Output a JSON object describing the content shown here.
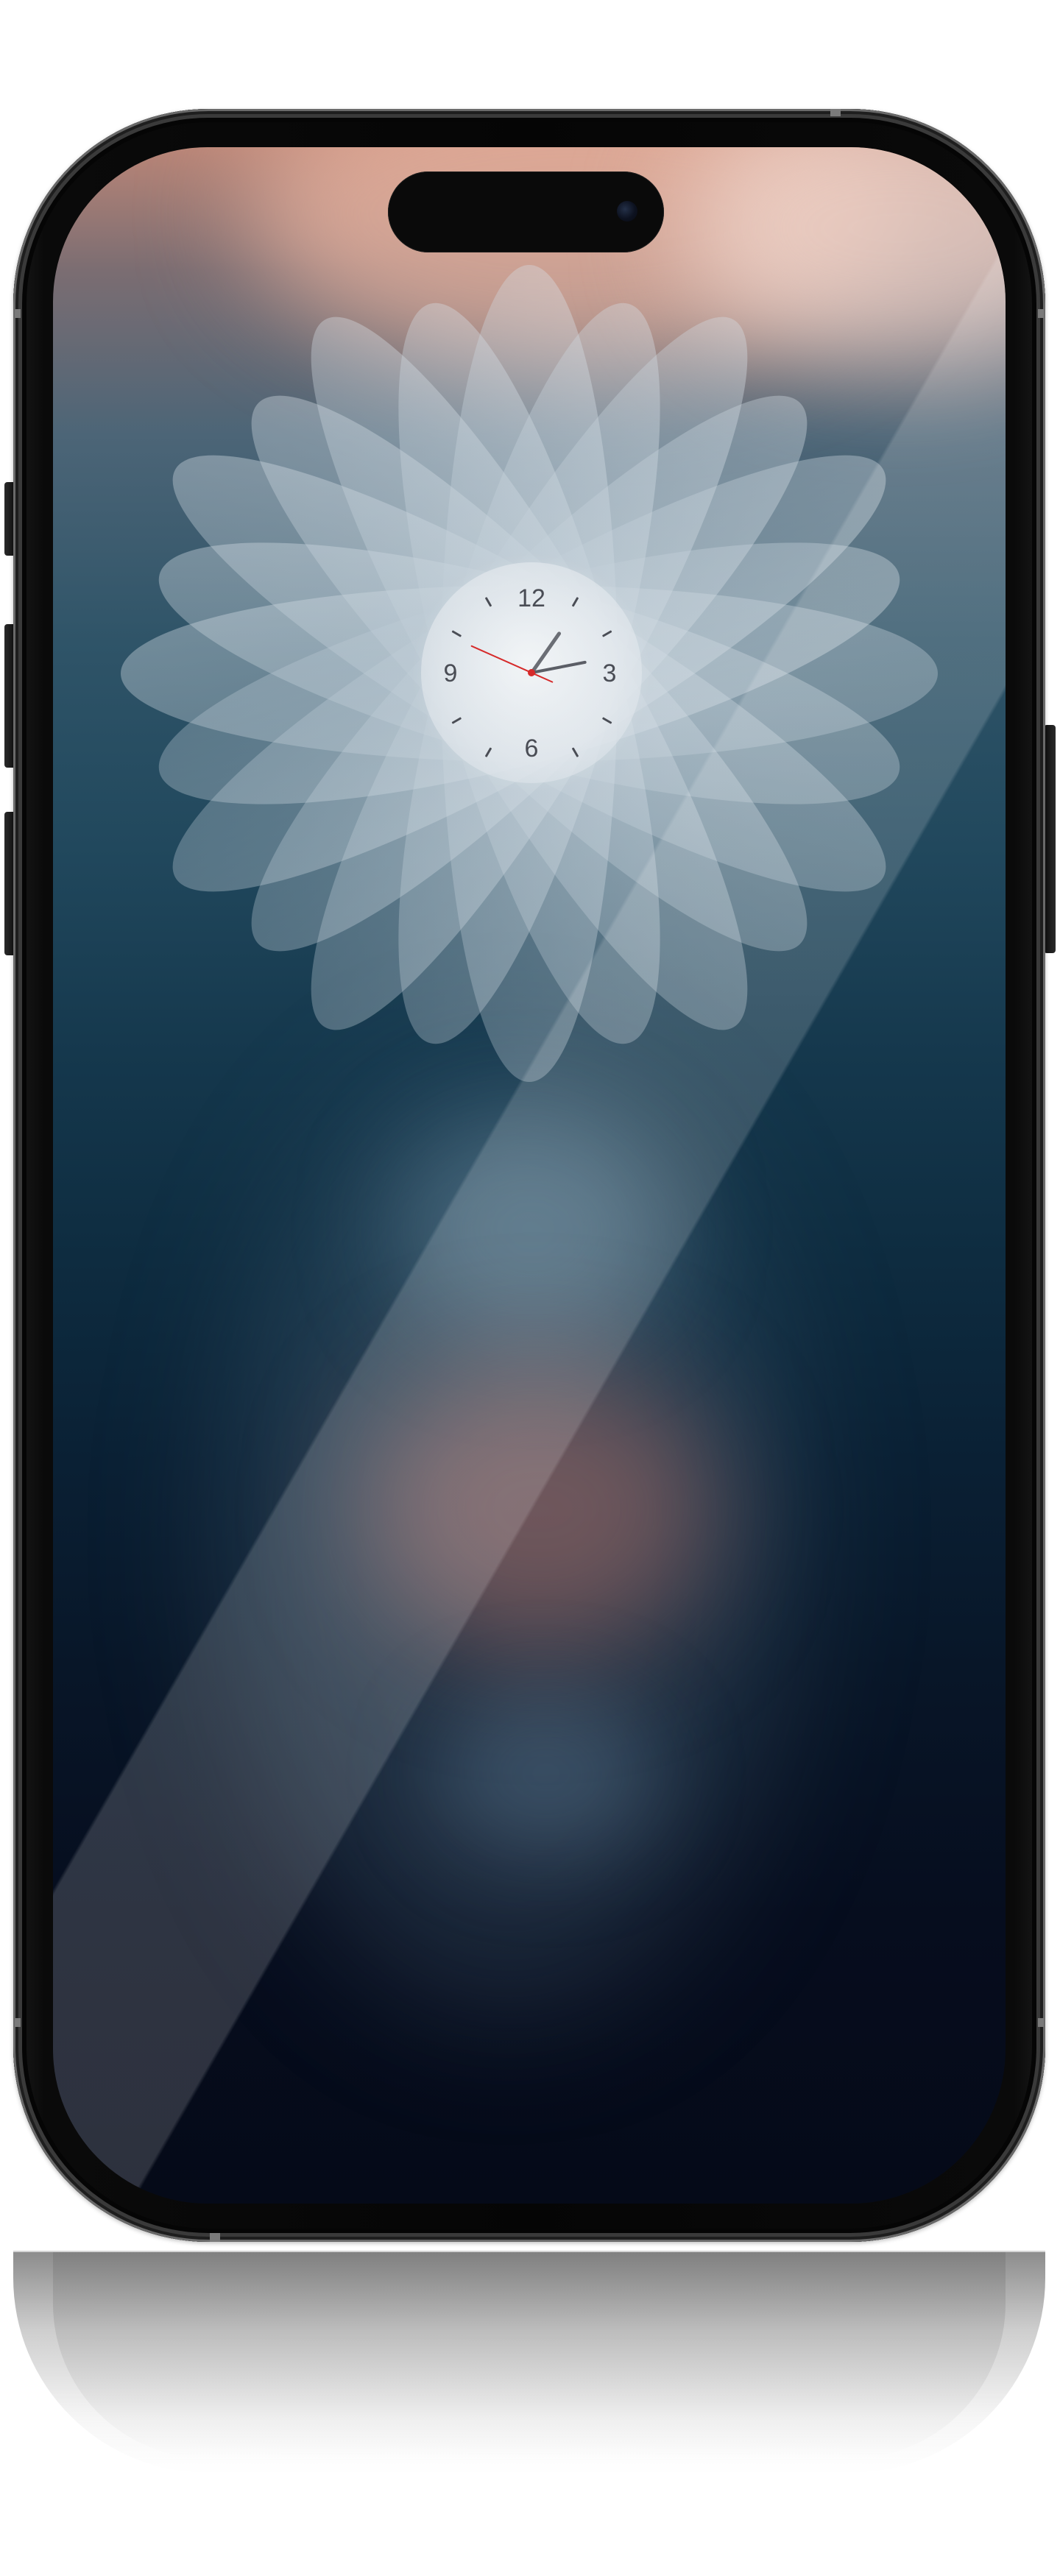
{
  "device": {
    "model_icon": "iphone-pro-frame",
    "frame_color": "#050505",
    "screen_state": "lock-screen"
  },
  "wallpaper": {
    "style": "blurred abstract",
    "colors": {
      "top": "#b98577",
      "middle": "#15384d",
      "bottom": "#050a18",
      "accent_pink": "#be786e",
      "accent_blue": "#789baf"
    }
  },
  "clock_widget": {
    "type": "analog",
    "petal_icon": "flower-petal-icon",
    "numerals": {
      "twelve": "12",
      "three": "3",
      "six": "6",
      "nine": "9"
    },
    "second_hand_color": "#d62a2a"
  }
}
